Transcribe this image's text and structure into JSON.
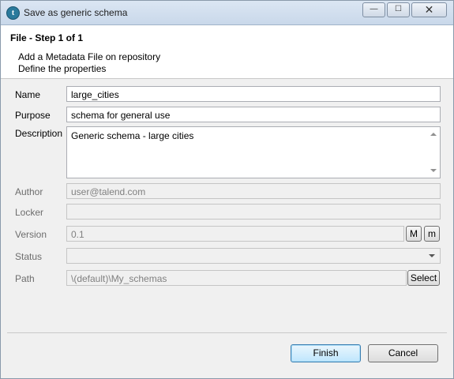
{
  "window": {
    "title": "Save as generic schema",
    "app_icon": "talend-app-icon",
    "controls": {
      "minimize": "—",
      "maximize": "☐",
      "close": "✕"
    }
  },
  "header": {
    "step_title": "File - Step 1 of 1",
    "description_lines": [
      "Add a Metadata File on repository",
      "Define the properties"
    ]
  },
  "form": {
    "name": {
      "label": "Name",
      "value": "large_cities"
    },
    "purpose": {
      "label": "Purpose",
      "value": "schema for general use"
    },
    "description": {
      "label": "Description",
      "value": "Generic schema - large cities"
    },
    "author": {
      "label": "Author",
      "value": "user@talend.com"
    },
    "locker": {
      "label": "Locker",
      "value": ""
    },
    "version": {
      "label": "Version",
      "value": "0.1",
      "major_button": "M",
      "minor_button": "m"
    },
    "status": {
      "label": "Status",
      "value": ""
    },
    "path": {
      "label": "Path",
      "value": "\\(default)\\My_schemas",
      "select_button": "Select"
    }
  },
  "footer": {
    "finish_label": "Finish",
    "cancel_label": "Cancel"
  }
}
